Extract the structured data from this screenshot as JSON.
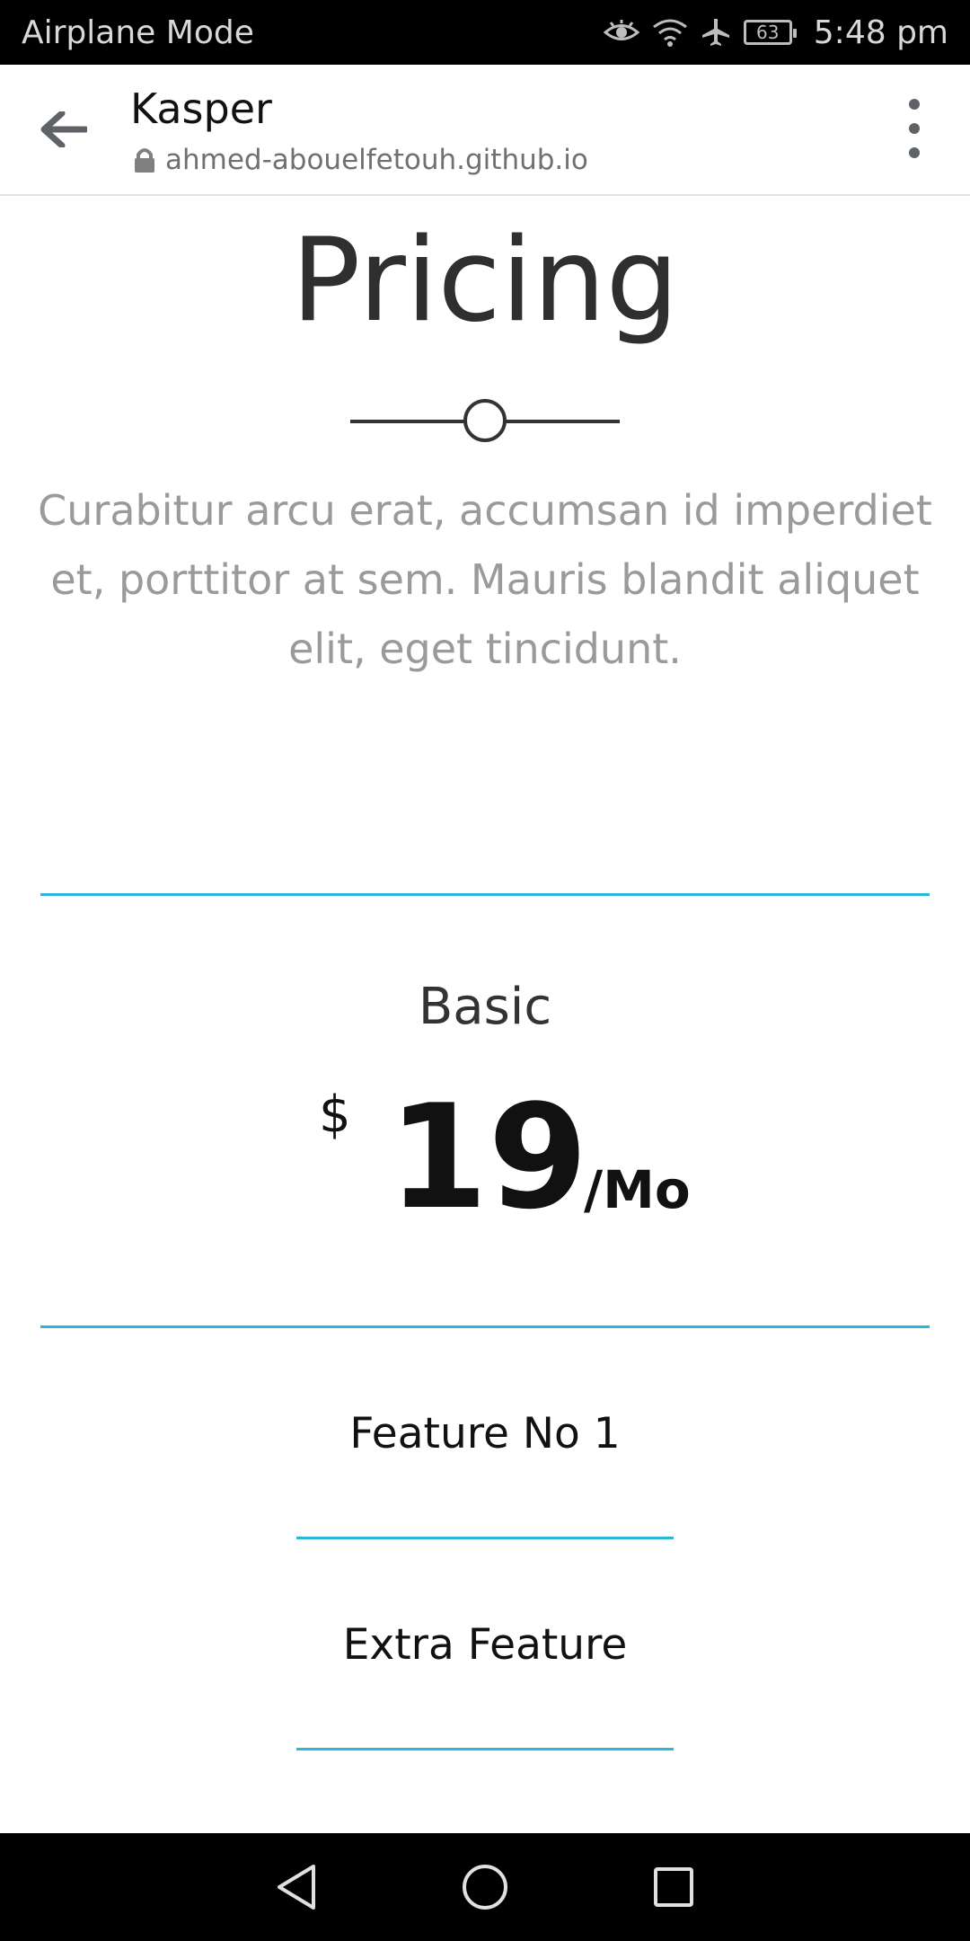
{
  "status_bar": {
    "left_text": "Airplane Mode",
    "battery_level": "63",
    "time": "5:48 pm"
  },
  "toolbar": {
    "title": "Kasper",
    "url": "ahmed-abouelfetouh.github.io"
  },
  "section": {
    "title": "Pricing",
    "description": "Curabitur arcu erat, accumsan id imperdiet et, porttitor at sem. Mauris blandit aliquet elit, eget tincidunt."
  },
  "plan": {
    "name": "Basic",
    "currency": "$",
    "amount": "19",
    "period": "/Mo",
    "features": [
      "Feature No 1",
      "Extra Feature"
    ]
  },
  "colors": {
    "accent": "#2bb7da",
    "heading": "#2f2f2f",
    "muted_text": "#9a9a9a"
  },
  "icons": {
    "status": [
      "eye-icon",
      "wifi-icon",
      "airplane-icon",
      "battery-icon"
    ],
    "toolbar": [
      "back-arrow-icon",
      "lock-icon",
      "more-vert-icon"
    ],
    "nav": [
      "nav-back-icon",
      "nav-home-icon",
      "nav-recents-icon"
    ]
  }
}
